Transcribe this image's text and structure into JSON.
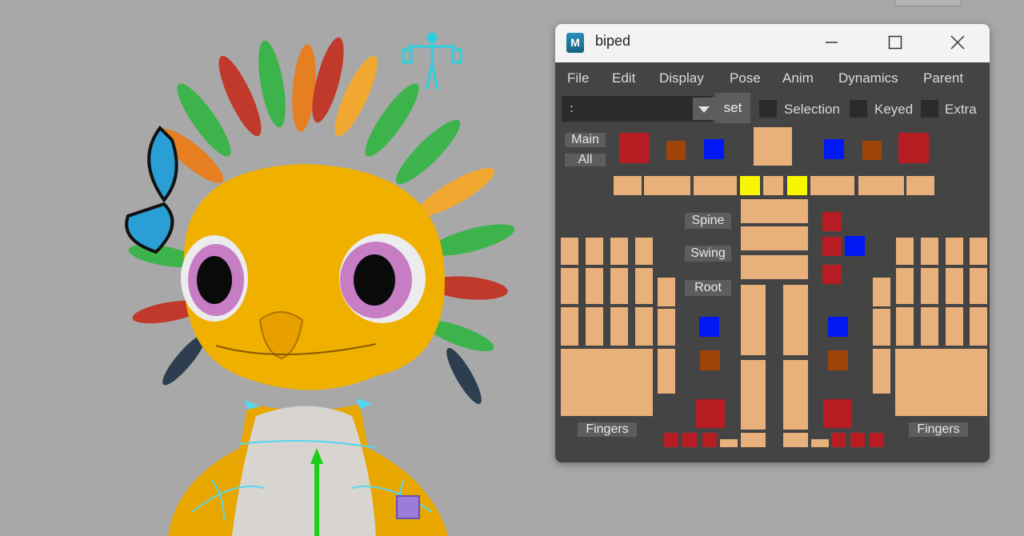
{
  "window": {
    "title": "biped",
    "controls": {
      "minimize": "minimize-icon",
      "maximize": "maximize-icon",
      "close": "close-icon"
    }
  },
  "menu": [
    "File",
    "Edit",
    "Display",
    "Pose",
    "Anim",
    "Dynamics",
    "Parent"
  ],
  "toolbar": {
    "namespace_value": ":",
    "set_label": "set",
    "checkboxes": [
      "Selection",
      "Keyed",
      "Extra"
    ]
  },
  "picker": {
    "labels": {
      "main": "Main",
      "all": "All",
      "spine": "Spine",
      "swing": "Swing",
      "root": "Root",
      "fingers_right": "Fingers",
      "fingers_left": "Fingers"
    }
  },
  "colors": {
    "skin": "#e8b07a",
    "red": "#b71c23",
    "blue": "#0019f5",
    "brown": "#9e4408",
    "yellow": "#f7f700",
    "panel": "#444444",
    "button": "#5d5d5d"
  }
}
